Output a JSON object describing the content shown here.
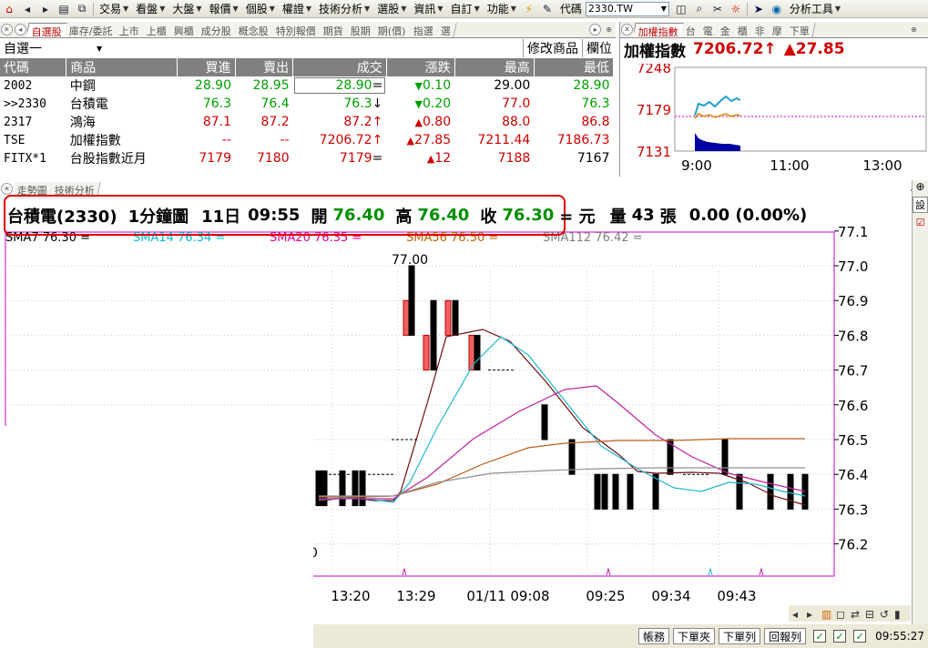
{
  "toolbar": {
    "menus": [
      "交易",
      "看盤",
      "大盤",
      "報價",
      "個股",
      "權證",
      "技術分析",
      "選股",
      "資訊",
      "自訂",
      "功能"
    ],
    "code_label": "代碼",
    "code_value": "2330.TW",
    "analysis_tool": "分析工具"
  },
  "watchlist": {
    "tabs": [
      "自選股",
      "庫存/委託",
      "上市",
      "上櫃",
      "興櫃",
      "成分股",
      "概念股",
      "特別報價",
      "期貨",
      "股期",
      "期(價)",
      "指選",
      "選"
    ],
    "group": "自選一",
    "edit_label": "修改商品",
    "column_label": "欄位",
    "headers": [
      "代碼",
      "商品",
      "買進",
      "賣出",
      "成交",
      "漲跌",
      "最高",
      "最低"
    ],
    "rows": [
      {
        "code": "2002",
        "name": "中鋼",
        "bid": "28.90",
        "ask": "28.95",
        "last": "28.90",
        "last_mark": "=",
        "chg_arrow": "▼",
        "chg": "0.10",
        "high": "29.00",
        "low": "28.90",
        "dir": "down",
        "high_dir": "flat",
        "low_dir": "down"
      },
      {
        "code": ">>2330",
        "name": "台積電",
        "bid": "76.3",
        "ask": "76.4",
        "last": "76.3",
        "last_mark": "↓",
        "chg_arrow": "▼",
        "chg": "0.20",
        "high": "77.0",
        "low": "76.3",
        "dir": "down",
        "high_dir": "up",
        "low_dir": "down"
      },
      {
        "code": "2317",
        "name": "鴻海",
        "bid": "87.1",
        "ask": "87.2",
        "last": "87.2",
        "last_mark": "↑",
        "chg_arrow": "▲",
        "chg": "0.80",
        "high": "88.0",
        "low": "86.8",
        "dir": "up",
        "high_dir": "up",
        "low_dir": "up"
      },
      {
        "code": "TSE",
        "name": "加權指數",
        "bid": "--",
        "ask": "--",
        "last": "7206.72",
        "last_mark": "↑",
        "chg_arrow": "▲",
        "chg": "27.85",
        "high": "7211.44",
        "low": "7186.73",
        "dir": "up",
        "high_dir": "up",
        "low_dir": "up"
      },
      {
        "code": "FITX*1",
        "name": "台股指數近月",
        "bid": "7179",
        "ask": "7180",
        "last": "7179",
        "last_mark": "=",
        "chg_arrow": "▲",
        "chg": "12",
        "high": "7188",
        "low": "7167",
        "dir": "up",
        "high_dir": "up",
        "low_dir": "flat"
      }
    ]
  },
  "index_panel": {
    "tabs": [
      "加權指數",
      "台",
      "電",
      "金",
      "櫃",
      "非",
      "摩",
      "下單"
    ],
    "title": "加權指數",
    "value": "7206.72",
    "value_mark": "↑",
    "change": "▲27.85",
    "y_labels": [
      "7248",
      "7179",
      "7131"
    ],
    "x_labels": [
      "9:00",
      "11:00",
      "13:00"
    ]
  },
  "chart": {
    "tabs": [
      "走勢圖",
      "技術分析"
    ],
    "info": {
      "name": "台積電(2330)",
      "period": "1分鐘圖",
      "day": "11日",
      "time": "09:55",
      "open_label": "開",
      "open": "76.40",
      "high_label": "高",
      "high": "76.40",
      "close_label": "收",
      "close": "76.30",
      "unit": "= 元",
      "vol_label": "量",
      "vol": "43",
      "vol_unit": "張",
      "change": "0.00 (0.00%)"
    },
    "sma_legend": [
      {
        "label": "SMA7 76.30 =",
        "color": "#000000"
      },
      {
        "label": "SMA14 76.34 =",
        "color": "#00bcd4"
      },
      {
        "label": "SMA20 76.35 =",
        "color": "#e00090"
      },
      {
        "label": "SMA56 76.50 =",
        "color": "#c06000"
      },
      {
        "label": "SMA112 76.42 =",
        "color": "#808080"
      }
    ],
    "peak_label": "77.00",
    "y_ticks": [
      "77.1",
      "77.0",
      "76.9",
      "76.8",
      "76.7",
      "76.6",
      "76.5",
      "76.4",
      "76.3",
      "76.2"
    ],
    "x_labels": [
      "13:20",
      "13:29",
      "01/11 09:08",
      "09:25",
      "09:34",
      "09:43"
    ],
    "left_fragment": "0"
  },
  "statusbar": {
    "buttons": [
      "帳務",
      "下單夾",
      "下單列",
      "回報列"
    ],
    "time": "09:55:27"
  },
  "colors": {
    "up": "#d00000",
    "down": "#00a000",
    "frame": "#cc00cc",
    "highlight": "#e00000"
  }
}
